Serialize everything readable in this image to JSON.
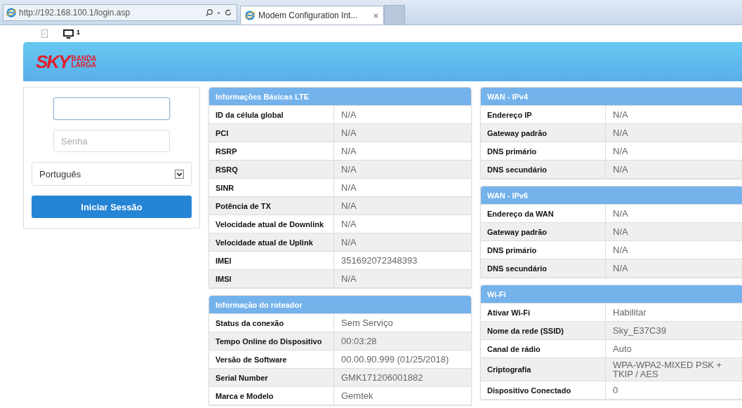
{
  "browser": {
    "address": "http://192.168.100.1/login.asp",
    "tab": {
      "title": "Modem Configuration Int...",
      "selected": true
    }
  },
  "toolbar": {
    "count": "1"
  },
  "logo": {
    "main": "SKY",
    "sub": [
      "BANDA",
      "LARGA"
    ]
  },
  "login": {
    "username": {
      "focused": true
    },
    "password": {
      "placeholder": "Senha"
    },
    "language": "Português",
    "button": "Iniciar Sessão"
  },
  "columns": [
    [
      {
        "title": "Informações Básicas LTE",
        "rows": [
          {
            "label": "ID da célula global",
            "value": "N/A"
          },
          {
            "label": "PCI",
            "value": "N/A"
          },
          {
            "label": "RSRP",
            "value": "N/A"
          },
          {
            "label": "RSRQ",
            "value": "N/A"
          },
          {
            "label": "SINR",
            "value": "N/A"
          },
          {
            "label": "Potência de TX",
            "value": "N/A"
          },
          {
            "label": "Velocidade atual de Downlink",
            "value": "N/A"
          },
          {
            "label": "Velocidade atual de Uplink",
            "value": "N/A"
          },
          {
            "label": "IMEI",
            "value": "351692072348393"
          },
          {
            "label": "IMSI",
            "value": "N/A"
          }
        ]
      },
      {
        "title": "Informação do roteador",
        "rows": [
          {
            "label": "Status da conexão",
            "value": "Sem Serviço"
          },
          {
            "label": "Tempo Online do Dispositivo",
            "value": "00:03:28"
          },
          {
            "label": "Versão de Software",
            "value": "00.00.90.999 (01/25/2018)"
          },
          {
            "label": "Serial Number",
            "value": "GMK171206001882"
          },
          {
            "label": "Marca e Modelo",
            "value": "Gemtek"
          }
        ]
      }
    ],
    [
      {
        "title": "WAN - IPv4",
        "rows": [
          {
            "label": "Endereço IP",
            "value": "N/A"
          },
          {
            "label": "Gateway padrão",
            "value": "N/A"
          },
          {
            "label": "DNS primário",
            "value": "N/A"
          },
          {
            "label": "DNS secundário",
            "value": "N/A"
          }
        ]
      },
      {
        "title": "WAN - IPv6",
        "rows": [
          {
            "label": "Endereço da WAN",
            "value": "N/A"
          },
          {
            "label": "Gateway padrão",
            "value": "N/A"
          },
          {
            "label": "DNS primário",
            "value": "N/A"
          },
          {
            "label": "DNS secundário",
            "value": "N/A"
          }
        ]
      },
      {
        "title": "Wi-Fi",
        "rows": [
          {
            "label": "Ativar Wi-Fi",
            "value": "Habilitar"
          },
          {
            "label": "Nome da rede (SSID)",
            "value": "Sky_E37C39"
          },
          {
            "label": "Canal de rádio",
            "value": "Auto"
          },
          {
            "label": "Criptografia",
            "value": "WPA-WPA2-MIXED PSK + TKIP / AES"
          },
          {
            "label": "Dispositivo Conectado",
            "value": "0"
          }
        ]
      }
    ]
  ]
}
